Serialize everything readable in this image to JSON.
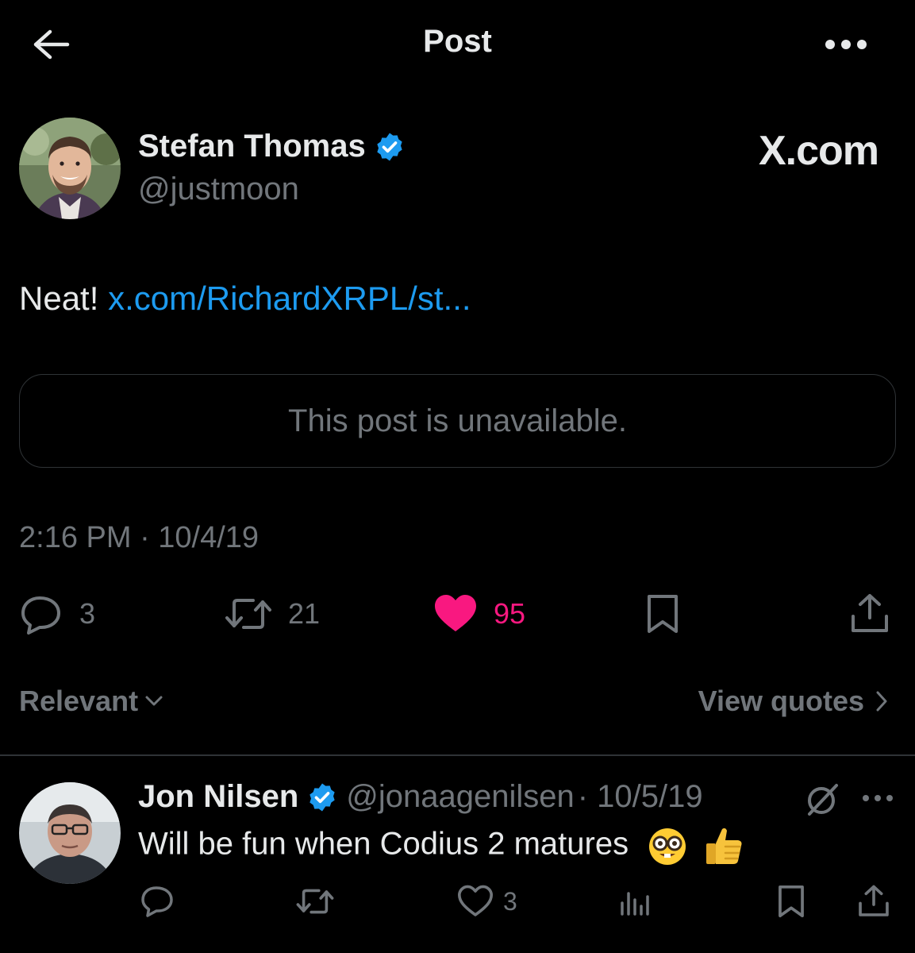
{
  "header": {
    "title": "Post",
    "back_icon": "arrow-left-icon",
    "more_icon": "more-horizontal-icon"
  },
  "post": {
    "author_name": "Stefan Thomas",
    "author_handle": "@justmoon",
    "source_label": "X.com",
    "text_prefix": "Neat!",
    "link_text": "x.com/RichardXRPL/st...",
    "quoted_unavailable": "This post is unavailable.",
    "timestamp": "2:16 PM · 10/4/19",
    "replies": "3",
    "reposts": "21",
    "likes": "95",
    "liked": true
  },
  "sort": {
    "label": "Relevant",
    "view_quotes": "View quotes"
  },
  "reply": {
    "author_name": "Jon Nilsen",
    "author_handle": "@jonaagenilsen",
    "date": "· 10/5/19",
    "text": "Will be fun when Codius 2 matures",
    "emojis": [
      "nerd-face-emoji",
      "thumbs-up-emoji"
    ],
    "likes": "3"
  },
  "colors": {
    "background": "#000000",
    "text": "#e7e9ea",
    "muted": "#71767b",
    "link": "#1d9bf0",
    "like": "#f91880",
    "verified": "#1d9bf0",
    "border": "#2f3336"
  }
}
